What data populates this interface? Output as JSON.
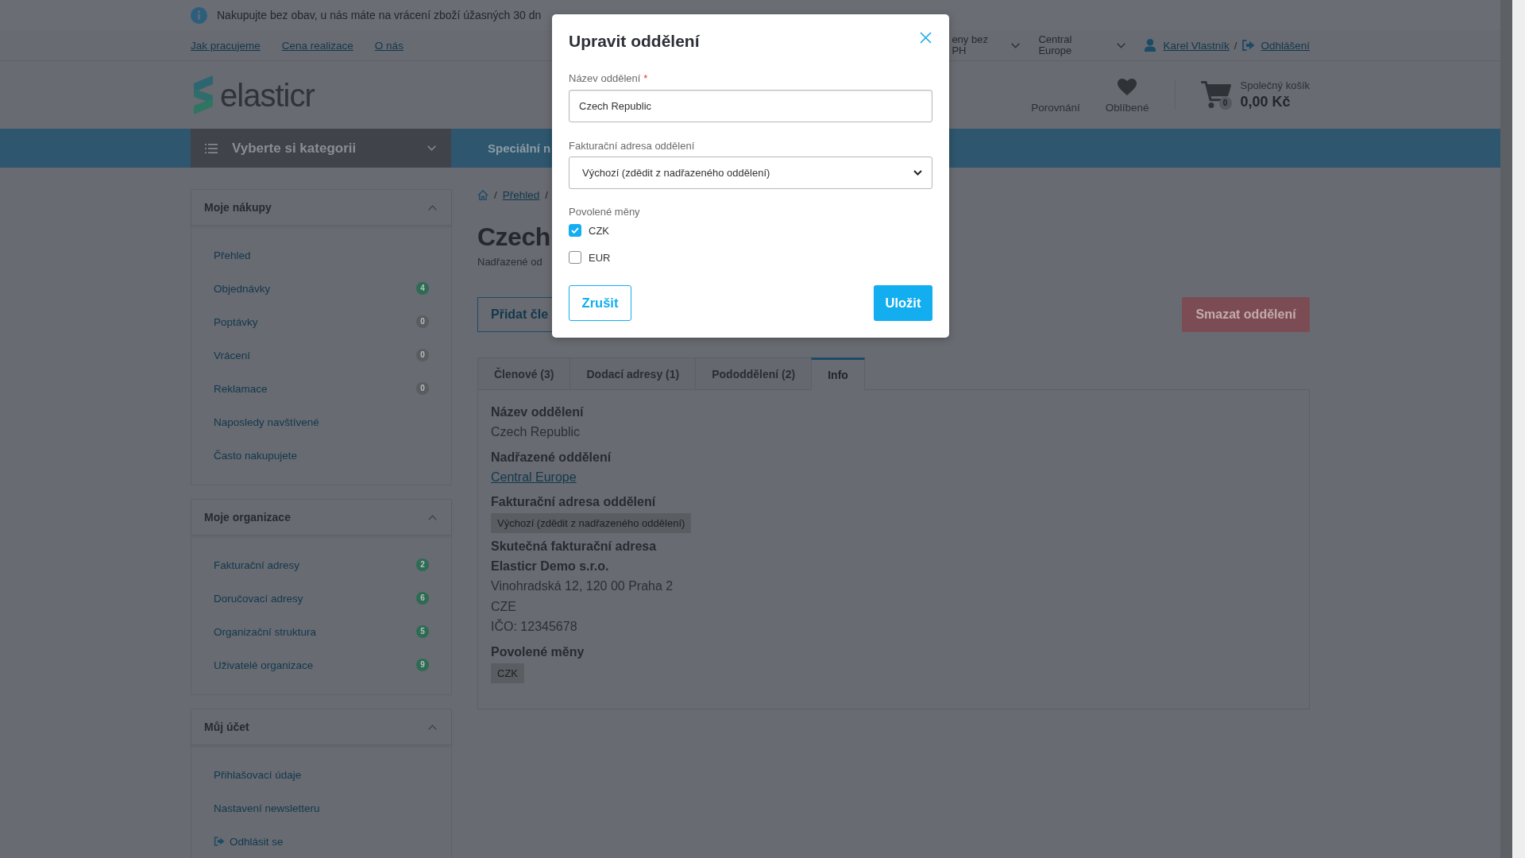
{
  "info_bar": {
    "text": "Nakupujte bez obav, u nás máte na vrácení zboží úžasných 30 dn"
  },
  "top_links": [
    "Jak pracujeme",
    "Cena realizace",
    "O nás"
  ],
  "price_dropdown": {
    "value": "eny bez PH"
  },
  "region_dropdown": {
    "value": "Central Europe"
  },
  "account": {
    "user": "Karel Vlastník",
    "separator": "/",
    "logout": "Odhlášení"
  },
  "logo": {
    "text": "elasticr"
  },
  "header_links": [
    {
      "kind": "compare",
      "label": "Porovnání"
    },
    {
      "kind": "favorites",
      "label": "Oblíbené"
    }
  ],
  "cart": {
    "label": "Společný košík",
    "total": "0,00 Kč",
    "count": "0"
  },
  "nav": {
    "categories_button": "Vyberte si kategorii",
    "items": [
      "Speciální n"
    ]
  },
  "sidebar": {
    "sections": [
      {
        "title": "Moje nákupy",
        "expanded": true,
        "items": [
          {
            "kind": "link",
            "label": "Přehled"
          },
          {
            "kind": "link",
            "label": "Objednávky",
            "badge": "4",
            "color": "#2e6b55"
          },
          {
            "kind": "link",
            "label": "Poptávky",
            "badge": "0",
            "color": "#595c61"
          },
          {
            "kind": "link",
            "label": "Vrácení",
            "badge": "0",
            "color": "#595c61"
          },
          {
            "kind": "link",
            "label": "Reklamace",
            "badge": "0",
            "color": "#595c61"
          },
          {
            "kind": "link",
            "label": "Naposledy navštívené"
          },
          {
            "kind": "link",
            "label": "Často nakupujete"
          }
        ]
      },
      {
        "title": "Moje organizace",
        "expanded": true,
        "items": [
          {
            "kind": "link",
            "label": "Fakturační adresy",
            "badge": "2",
            "color": "#2e6b55"
          },
          {
            "kind": "link",
            "label": "Doručovací adresy",
            "badge": "6",
            "color": "#2e6b55"
          },
          {
            "kind": "link",
            "label": "Organizační struktura",
            "badge": "5",
            "color": "#2e6b55"
          },
          {
            "kind": "link",
            "label": "Uživatelé organizace",
            "badge": "9",
            "color": "#2e6b55"
          }
        ]
      },
      {
        "title": "Můj účet",
        "expanded": true,
        "items": [
          {
            "kind": "link",
            "label": "Přihlašovací údaje"
          },
          {
            "kind": "link",
            "label": "Nastavení newsletteru"
          },
          {
            "kind": "logout",
            "label": "Odhlásit se"
          }
        ]
      }
    ]
  },
  "breadcrumb": [
    {
      "kind": "home"
    },
    {
      "kind": "separator",
      "text": "/"
    },
    {
      "kind": "link",
      "text": "Přehled"
    },
    {
      "kind": "separator",
      "text": "/"
    }
  ],
  "page_title": "Czech",
  "parent_line": "Nadřazené od",
  "buttons": {
    "add": "Přidat čle",
    "delete": "Smazat oddělení"
  },
  "tabs": [
    {
      "label": "Členové (3)",
      "selected": false
    },
    {
      "label": "Dodací adresy (1)",
      "selected": false
    },
    {
      "label": "Pododdělení (2)",
      "selected": false
    },
    {
      "label": "Info",
      "selected": true
    }
  ],
  "info_panel": {
    "fields": [
      {
        "kind": "text",
        "label": "Název oddělení",
        "values": [
          "Czech Republic"
        ]
      },
      {
        "kind": "link",
        "label": "Nadřazené oddělení",
        "values": [
          "Central Europe"
        ]
      },
      {
        "kind": "tag",
        "label": "Fakturační adresa oddělení",
        "values": [
          "Výchozí (zdědit z nadřazeného oddělení)"
        ]
      },
      {
        "kind": "address",
        "label": "Skutečná fakturační adresa",
        "name": "Elasticr Demo s.r.o.",
        "values": [
          "Vinohradská 12, 120 00 Praha 2",
          "CZE",
          "IČO: 12345678"
        ]
      },
      {
        "kind": "tag",
        "label": "Povolené měny",
        "values": [
          "CZK"
        ]
      }
    ]
  },
  "modal": {
    "title": "Upravit oddělení",
    "name_field": {
      "label": "Název oddělení",
      "required_mark": "*",
      "value": "Czech Republic"
    },
    "billing_field": {
      "label": "Fakturační adresa oddělení",
      "value": "Výchozí (zdědit z nadřazeného oddělení)"
    },
    "currencies": {
      "label": "Povolené měny",
      "options": [
        {
          "label": "CZK",
          "checked": true
        },
        {
          "label": "EUR",
          "checked": false
        }
      ]
    },
    "buttons": {
      "cancel": "Zrušit",
      "save": "Uložit"
    }
  }
}
